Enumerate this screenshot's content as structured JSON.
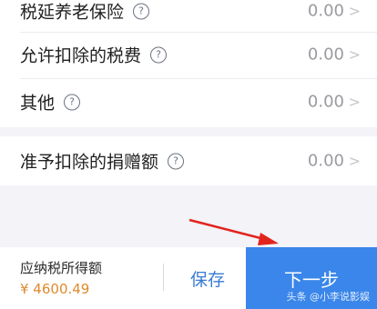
{
  "deductions": {
    "rows": [
      {
        "label": "税延养老保险",
        "help_icon": "?",
        "value": "0.00",
        "chevron": ">"
      },
      {
        "label": "允许扣除的税费",
        "help_icon": "?",
        "value": "0.00",
        "chevron": ">"
      },
      {
        "label": "其他",
        "help_icon": "?",
        "value": "0.00",
        "chevron": ">"
      }
    ],
    "donation_row": {
      "label": "准予扣除的捐赠额",
      "help_icon": "?",
      "value": "0.00",
      "chevron": ">"
    }
  },
  "bottom_bar": {
    "tax_label": "应纳税所得额",
    "tax_amount": "¥ 4600.49",
    "save_label": "保存",
    "next_label": "下一步"
  },
  "watermark": "头条 @小李说影娱",
  "colors": {
    "accent": "#3a86ea",
    "amount": "#e08a2b",
    "arrow": "#e2241d",
    "background": "#f3f3f8"
  }
}
